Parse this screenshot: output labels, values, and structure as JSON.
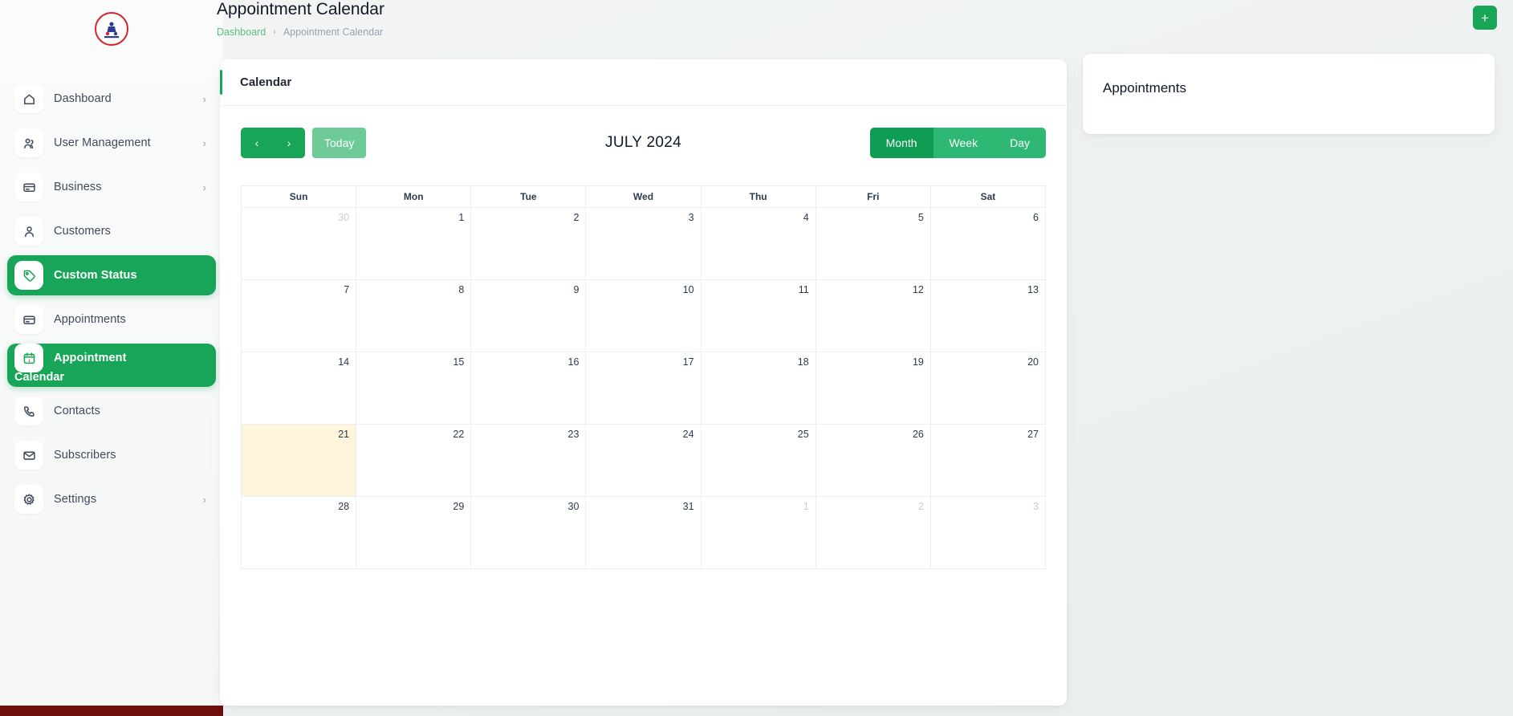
{
  "brand": {
    "logo_alt": "company-logo"
  },
  "sidebar": {
    "items": [
      {
        "label": "Dashboard",
        "icon": "home-icon",
        "chevron": "›",
        "active": false
      },
      {
        "label": "User Management",
        "icon": "users-icon",
        "chevron": "›",
        "active": false
      },
      {
        "label": "Business",
        "icon": "card-icon",
        "chevron": "›",
        "active": false
      },
      {
        "label": "Customers",
        "icon": "user-icon",
        "chevron": "",
        "active": false
      },
      {
        "label": "Custom Status",
        "icon": "tag-icon",
        "chevron": "",
        "active": true
      },
      {
        "label": "Appointments",
        "icon": "card-icon",
        "chevron": "",
        "active": false
      },
      {
        "label": "Appointment",
        "label_line2": "Calendar",
        "icon": "calendar-icon",
        "chevron": "",
        "active": true
      },
      {
        "label": "Contacts",
        "icon": "phone-icon",
        "chevron": "",
        "active": false
      },
      {
        "label": "Subscribers",
        "icon": "mail-icon",
        "chevron": "",
        "active": false
      },
      {
        "label": "Settings",
        "icon": "gear-icon",
        "chevron": "›",
        "active": false
      }
    ]
  },
  "header": {
    "title": "Appointment Calendar",
    "breadcrumb": {
      "root": "Dashboard",
      "separator": "›",
      "current": "Appointment Calendar"
    },
    "add_button_label": "+"
  },
  "calendar_card": {
    "title": "Calendar",
    "toolbar": {
      "prev_label": "‹",
      "next_label": "›",
      "today_label": "Today",
      "period_title": "JULY 2024",
      "views": [
        {
          "label": "Month",
          "active": true
        },
        {
          "label": "Week",
          "active": false
        },
        {
          "label": "Day",
          "active": false
        }
      ]
    },
    "daynames": [
      "Sun",
      "Mon",
      "Tue",
      "Wed",
      "Thu",
      "Fri",
      "Sat"
    ],
    "weeks": [
      [
        {
          "day": "30",
          "other": true,
          "today": false
        },
        {
          "day": "1",
          "other": false,
          "today": false
        },
        {
          "day": "2",
          "other": false,
          "today": false
        },
        {
          "day": "3",
          "other": false,
          "today": false
        },
        {
          "day": "4",
          "other": false,
          "today": false
        },
        {
          "day": "5",
          "other": false,
          "today": false
        },
        {
          "day": "6",
          "other": false,
          "today": false
        }
      ],
      [
        {
          "day": "7",
          "other": false,
          "today": false
        },
        {
          "day": "8",
          "other": false,
          "today": false
        },
        {
          "day": "9",
          "other": false,
          "today": false
        },
        {
          "day": "10",
          "other": false,
          "today": false
        },
        {
          "day": "11",
          "other": false,
          "today": false
        },
        {
          "day": "12",
          "other": false,
          "today": false
        },
        {
          "day": "13",
          "other": false,
          "today": false
        }
      ],
      [
        {
          "day": "14",
          "other": false,
          "today": false
        },
        {
          "day": "15",
          "other": false,
          "today": false
        },
        {
          "day": "16",
          "other": false,
          "today": false
        },
        {
          "day": "17",
          "other": false,
          "today": false
        },
        {
          "day": "18",
          "other": false,
          "today": false
        },
        {
          "day": "19",
          "other": false,
          "today": false
        },
        {
          "day": "20",
          "other": false,
          "today": false
        }
      ],
      [
        {
          "day": "21",
          "other": false,
          "today": true
        },
        {
          "day": "22",
          "other": false,
          "today": false
        },
        {
          "day": "23",
          "other": false,
          "today": false
        },
        {
          "day": "24",
          "other": false,
          "today": false
        },
        {
          "day": "25",
          "other": false,
          "today": false
        },
        {
          "day": "26",
          "other": false,
          "today": false
        },
        {
          "day": "27",
          "other": false,
          "today": false
        }
      ],
      [
        {
          "day": "28",
          "other": false,
          "today": false
        },
        {
          "day": "29",
          "other": false,
          "today": false
        },
        {
          "day": "30",
          "other": false,
          "today": false
        },
        {
          "day": "31",
          "other": false,
          "today": false
        },
        {
          "day": "1",
          "other": true,
          "today": false
        },
        {
          "day": "2",
          "other": true,
          "today": false
        },
        {
          "day": "3",
          "other": true,
          "today": false
        }
      ]
    ]
  },
  "appointments_panel": {
    "title": "Appointments"
  },
  "colors": {
    "accent_green": "#18a558",
    "accent_green_light": "#6ecb98",
    "view_active": "#0e9d52",
    "today_highlight": "#fdf6dd",
    "breadcrumb_link": "#5bbd7f",
    "scrollbar_thumb": "#6d0d0d",
    "logo_ring": "#d8232a"
  }
}
